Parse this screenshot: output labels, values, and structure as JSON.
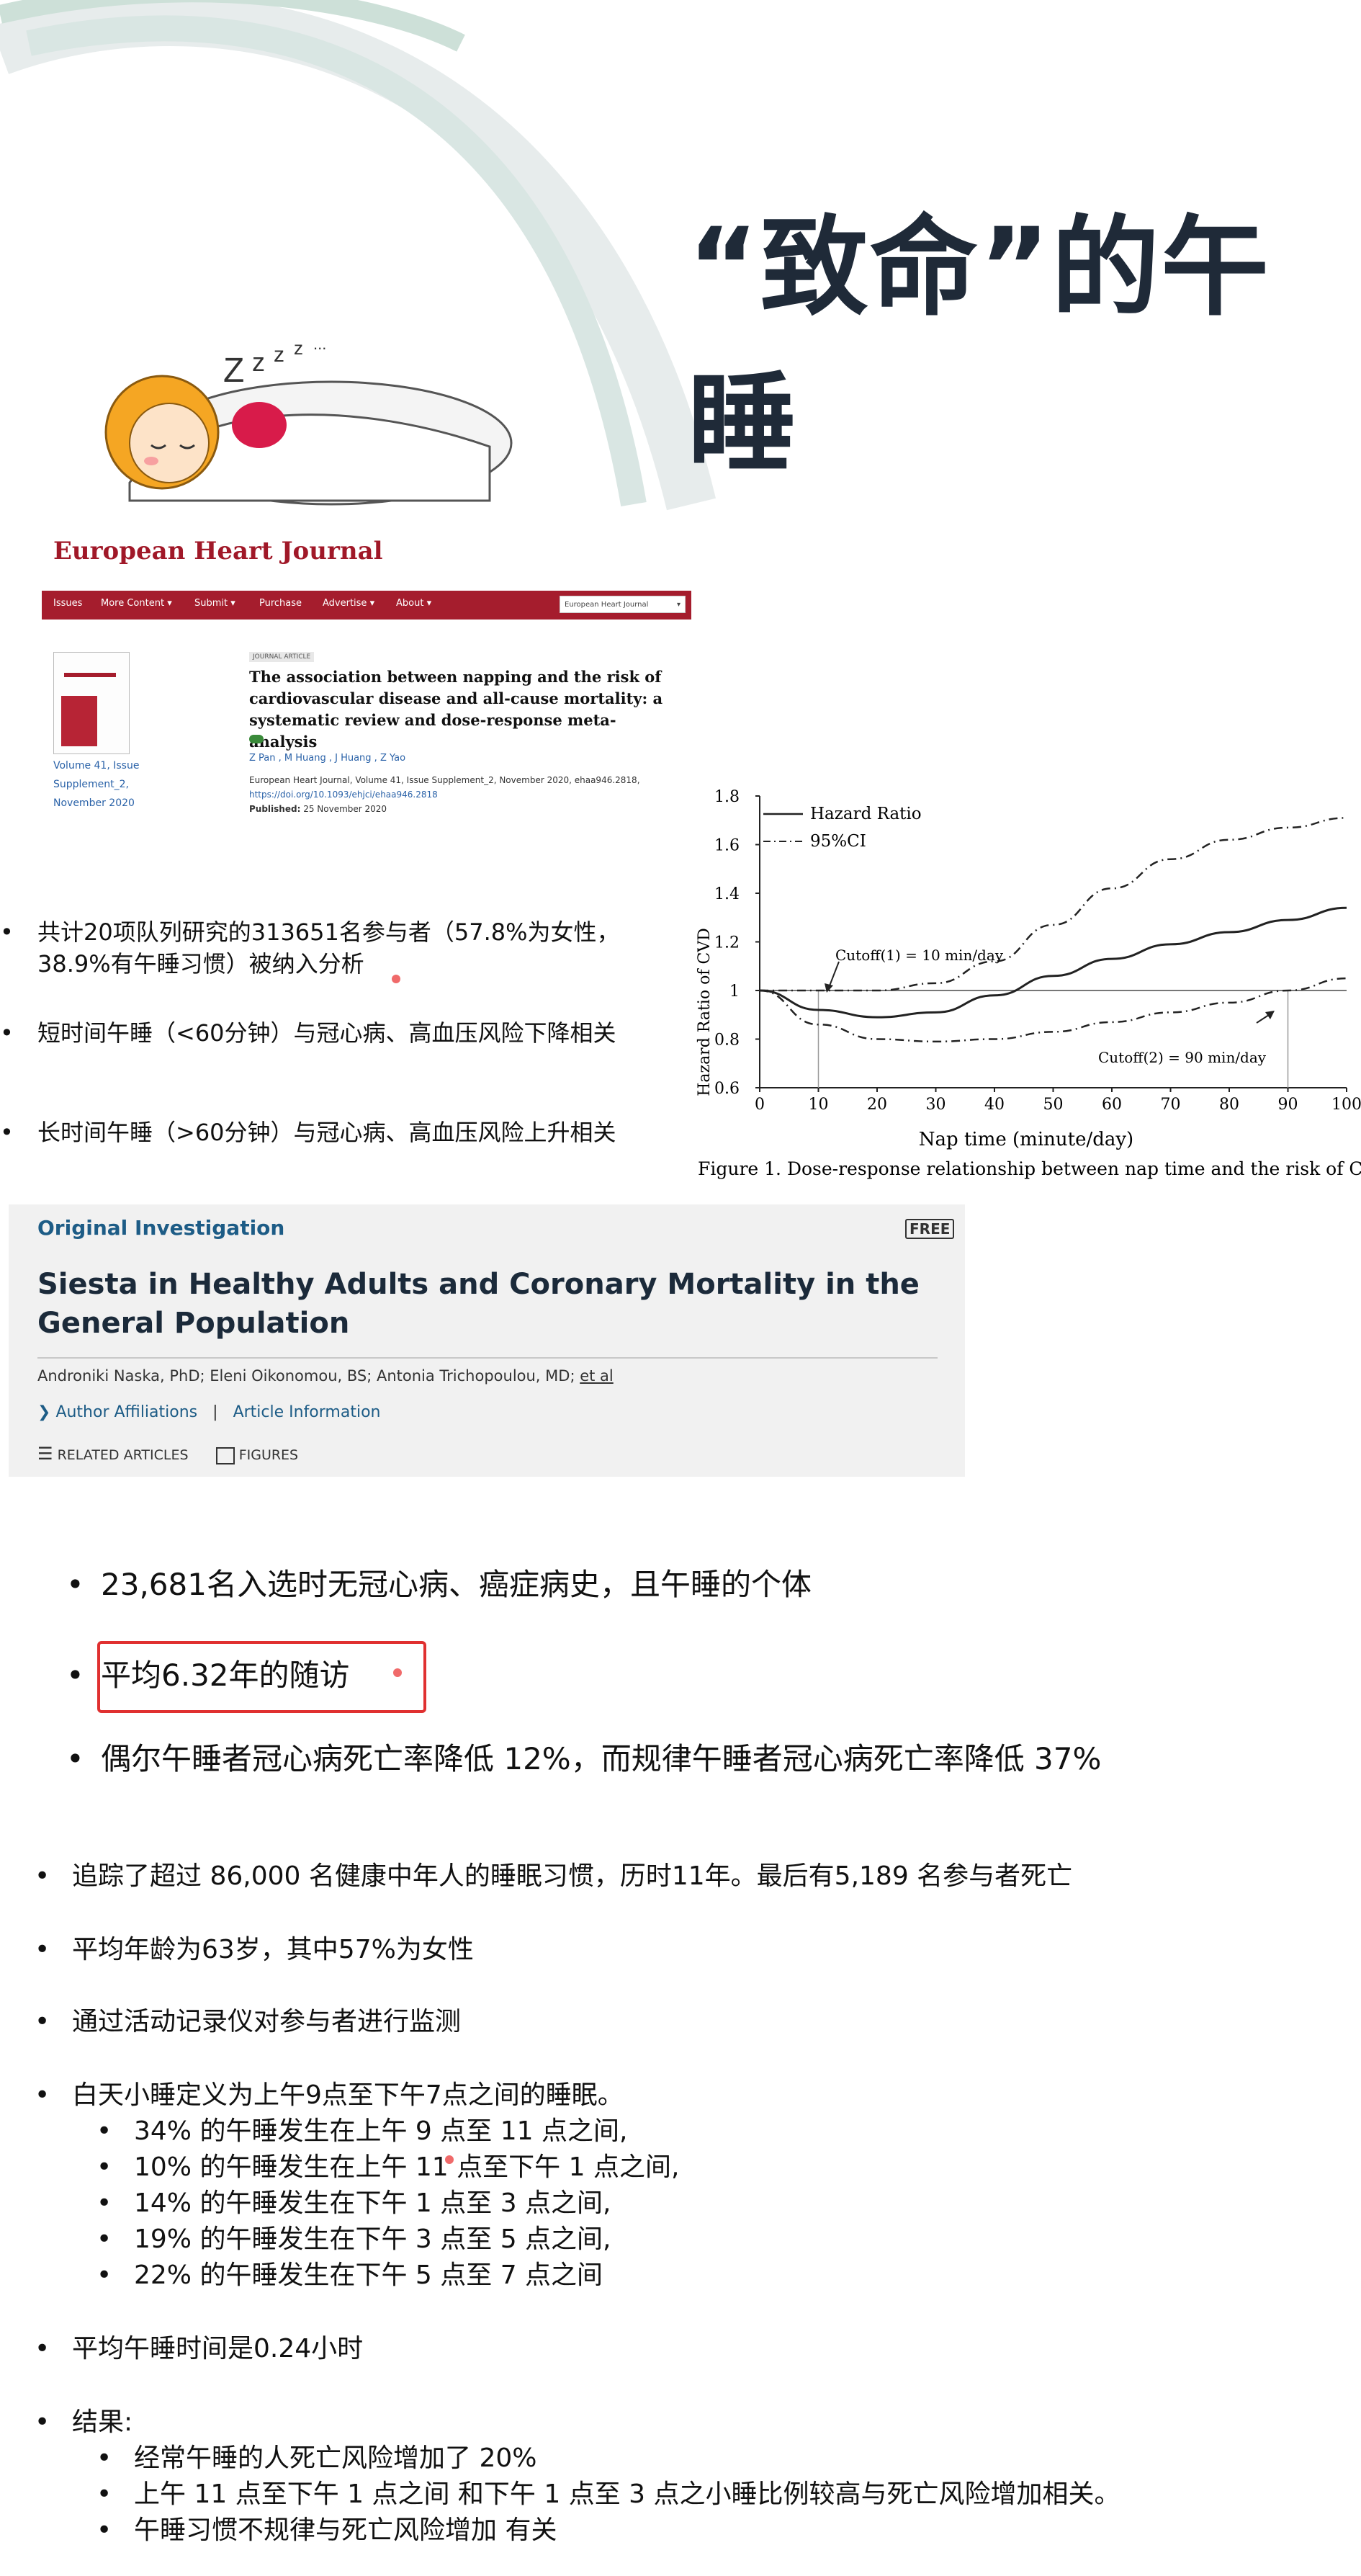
{
  "slide": {
    "title": "“致命”的午睡"
  },
  "ehj": {
    "journal_name": "European Heart Journal",
    "nav": [
      "Issues",
      "More Content ▾",
      "Submit ▾",
      "Purchase",
      "Advertise ▾",
      "About ▾"
    ],
    "search_label": "European Heart Journal",
    "volume_link": [
      "Volume 41, Issue",
      "Supplement_2,",
      "November 2020"
    ],
    "badge": "JOURNAL ARTICLE",
    "article_title": "The association between napping and the risk of cardiovascular disease and all-cause mortality: a systematic review and dose-response meta-analysis",
    "authors": "Z Pan , M Huang , J Huang , Z Yao",
    "citation": "European Heart Journal, Volume 41, Issue Supplement_2, November 2020, ehaa946.2818,",
    "doi": "https://doi.org/10.1093/ehjci/ehaa946.2818",
    "published_label": "Published:",
    "published_date": "25 November 2020"
  },
  "meta_bullets": [
    "共计20项队列研究的313651名参与者（57.8%为女性，38.9%有午睡习惯）被纳入分析",
    "短时间午睡（<60分钟）与冠心病、高血压风险下降相关",
    "长时间午睡（>60分钟）与冠心病、高血压风险上升相关"
  ],
  "chart_data": {
    "type": "line",
    "caption": "Figure 1. Dose-response relationship between nap time and the risk of CVD",
    "xlabel": "Nap time (minute/day)",
    "ylabel": "Hazard Ratio of CVD",
    "xlim": [
      0,
      100
    ],
    "ylim": [
      0.6,
      1.8
    ],
    "xticks": [
      "0",
      "10",
      "20",
      "30",
      "40",
      "50",
      "60",
      "70",
      "80",
      "90",
      "100"
    ],
    "yticks": [
      "0.6",
      "0.8",
      "1",
      "1.2",
      "1.4",
      "1.6",
      "1.8"
    ],
    "legend": [
      "Hazard Ratio",
      "95%CI"
    ],
    "legend_position": "top-left",
    "annotations": [
      "Cutoff(1) = 10 min/day",
      "Cutoff(2) = 90 min/day"
    ],
    "series": [
      {
        "name": "Hazard Ratio",
        "style": "solid",
        "x": [
          0,
          10,
          20,
          30,
          40,
          50,
          60,
          70,
          80,
          90,
          100
        ],
        "y": [
          1.0,
          0.92,
          0.89,
          0.91,
          0.98,
          1.06,
          1.13,
          1.19,
          1.24,
          1.29,
          1.34
        ]
      },
      {
        "name": "95%CI",
        "style": "dashdot",
        "x": [
          0,
          10,
          20,
          30,
          40,
          50,
          60,
          70,
          80,
          90,
          100
        ],
        "y": [
          1.0,
          1.0,
          1.0,
          1.03,
          1.12,
          1.27,
          1.42,
          1.54,
          1.62,
          1.67,
          1.71
        ]
      },
      {
        "name": "95%CI",
        "style": "dashdot",
        "x": [
          0,
          10,
          20,
          30,
          40,
          50,
          60,
          70,
          80,
          90,
          100
        ],
        "y": [
          1.0,
          0.86,
          0.8,
          0.79,
          0.8,
          0.83,
          0.87,
          0.91,
          0.95,
          1.0,
          1.05
        ]
      }
    ],
    "reference_line_y": 1,
    "cutoff_x": [
      10,
      90
    ]
  },
  "jama": {
    "kicker": "Original Investigation",
    "free": "FREE",
    "title": "Siesta in Healthy Adults and Coronary Mortality in the General Population",
    "authors": "Androniki Naska, PhD; Eleni Oikonomou, BS; Antonia Trichopoulou, MD;",
    "et_al": "et al",
    "link1": "Author Affiliations",
    "link_sep": "|",
    "link2": "Article Information",
    "tool1": "RELATED ARTICLES",
    "tool2": "FIGURES"
  },
  "siesta_bullets": [
    "23,681名入选时无冠心病、癌症病史，且午睡的个体",
    "平均6.32年的随访",
    "偶尔午睡者冠心病死亡率降低 12%，而规律午睡者冠心病死亡率降低 37%"
  ],
  "study_bullets": {
    "b1": "追踪了超过 86,000 名健康中年人的睡眠习惯，历时11年。最后有5,189 名参与者死亡",
    "b2": "平均年龄为63岁，其中57%为女性",
    "b3": "通过活动记录仪对参与者进行监测",
    "b4": "白天小睡定义为上午9点至下午7点之间的睡眠。",
    "b4_sub": [
      "34% 的午睡发生在上午 9 点至 11 点之间,",
      "10% 的午睡发生在上午 11 点至下午 1 点之间,",
      "14% 的午睡发生在下午 1 点至 3 点之间,",
      "19% 的午睡发生在下午 3 点至 5 点之间,",
      "22% 的午睡发生在下午 5 点至 7 点之间"
    ],
    "b5": "平均午睡时间是0.24小时",
    "b6": "结果:",
    "b6_sub": [
      "经常午睡的人死亡风险增加了 20%",
      "上午 11 点至下午 1 点之间 和下午 1 点至 3 点之小睡比例较高与死亡风险增加相关。",
      "午睡习惯不规律与死亡风险增加 有关"
    ]
  },
  "colors": {
    "title": "#1f2a38",
    "ehj_red": "#a51d2d",
    "jama_blue": "#1d5c86",
    "highlight_box": "#e03030",
    "arc_light": "#d8e4e2"
  }
}
